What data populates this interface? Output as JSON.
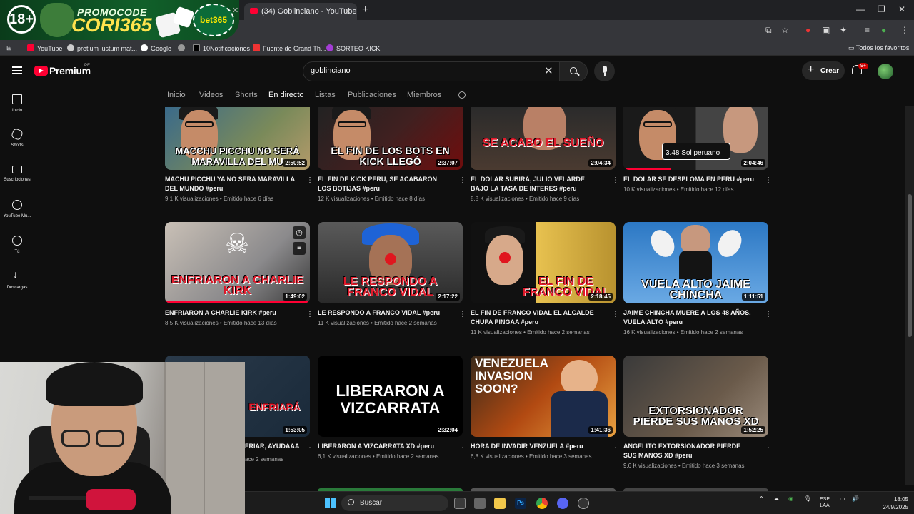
{
  "promo": {
    "age": "18+",
    "line1": "PROMOCODE",
    "line2": "CORI365",
    "brand": "bet365"
  },
  "browser": {
    "tab_title": "(34) Goblinciano - YouTube",
    "bookmarks": [
      "YouTube",
      "pretium iustum mat...",
      "Google",
      "",
      "10Notificaciones",
      "Fuente de Grand Th...",
      "SORTEO KICK"
    ],
    "all_bookmarks": "Todos los favoritos"
  },
  "yt": {
    "logo": "Premium",
    "logo_region": "PE",
    "search_value": "goblinciano",
    "create": "Crear",
    "badge": "9+"
  },
  "sidebar": [
    {
      "label": "Inicio",
      "icon": "home-icon"
    },
    {
      "label": "Shorts",
      "icon": "shorts-icon"
    },
    {
      "label": "Suscripciones",
      "icon": "subscriptions-icon"
    },
    {
      "label": "YouTube Mu...",
      "icon": "music-icon"
    },
    {
      "label": "Tú",
      "icon": "you-icon"
    },
    {
      "label": "Descargas",
      "icon": "download-icon"
    }
  ],
  "tabs": [
    "Inicio",
    "Videos",
    "Shorts",
    "En directo",
    "Listas",
    "Publicaciones",
    "Miembros"
  ],
  "active_tab": "En directo",
  "videos": [
    {
      "caption": "MACCHU PICCHU NO SERÁ MARAVILLA DEL MU",
      "duration": "2:50:52",
      "title": "MACHU PICCHU YA NO SERA MARAVILLA DEL MUNDO #peru",
      "meta": "9,1 K visualizaciones • Emitido hace 6 días",
      "progress": 1.0
    },
    {
      "caption": "EL FIN DE LOS BOTS EN KICK LLEGÓ",
      "duration": "2:37:07",
      "title": "EL FIN DE KICK PERU, SE ACABARON LOS BOTIJAS #peru",
      "meta": "12 K visualizaciones • Emitido hace 8 días",
      "progress": 1.0
    },
    {
      "caption": "SE ACABO EL SUEÑO",
      "duration": "2:04:34",
      "title": "EL DOLAR SUBIRÁ, JULIO VELARDE BAJO LA TASA DE INTERES #peru",
      "meta": "8,8 K visualizaciones • Emitido hace 9 días",
      "progress": 0
    },
    {
      "caption": "3.48 Sol peruano",
      "duration": "2:04:46",
      "title": "EL DOLAR SE DESPLOMA EN PERU #peru",
      "meta": "10 K visualizaciones • Emitido hace 12 días",
      "progress": 0.33
    },
    {
      "caption": "ENFRIARON A CHARLIE KIRK",
      "duration": "1:49:02",
      "title": "ENFRIARON A CHARLIE KIRK #peru",
      "meta": "8,5 K visualizaciones • Emitido hace 13 días",
      "progress": 1.0
    },
    {
      "caption": "LE RESPONDO A FRANCO VIDAL",
      "duration": "2:17:22",
      "title": "LE RESPONDO A FRANCO VIDAL #peru",
      "meta": "11 K visualizaciones • Emitido hace 2 semanas",
      "progress": 0
    },
    {
      "caption": "EL FIN DE FRANCO VIDAL",
      "duration": "2:18:45",
      "title": "EL FIN DE FRANCO VIDAL EL ALCALDE CHUPA PINGAA #peru",
      "meta": "11 K visualizaciones • Emitido hace 2 semanas",
      "progress": 0
    },
    {
      "caption": "VUELA ALTO JAIME CHINCHA",
      "duration": "1:11:51",
      "title": "JAIME CHINCHA MUERE A LOS 48 AÑOS, VUELA ALTO #peru",
      "meta": "16 K visualizaciones • Emitido hace 2 semanas",
      "progress": 0
    },
    {
      "caption": "ENFRIARÁ",
      "duration": "1:53:05",
      "title": "FRIAR, AYUDAAA",
      "meta": "ace 2 semanas",
      "progress": 0
    },
    {
      "caption": "LIBERARON A VIZCARRATA",
      "duration": "2:32:04",
      "title": "LIBERARON A VIZCARRATA XD #peru",
      "meta": "6,1 K visualizaciones • Emitido hace 2 semanas",
      "progress": 0
    },
    {
      "caption": "VENEZUELA INVASION SOON?",
      "duration": "1:41:36",
      "title": "HORA DE INVADIR VENZUELA #peru",
      "meta": "6,8 K visualizaciones • Emitido hace 3 semanas",
      "progress": 0
    },
    {
      "caption": "EXTORSIONADOR PIERDE SUS MANOS XD",
      "duration": "1:52:25",
      "title": "ANGELITO EXTORSIONADOR PIERDE SUS MANOS XD #peru",
      "meta": "9,6 K visualizaciones • Emitido hace 3 semanas",
      "progress": 0
    }
  ],
  "taskbar": {
    "search": "Buscar",
    "lang1": "ESP",
    "lang2": "LAA",
    "time": "18:05",
    "date": "24/9/2025"
  }
}
